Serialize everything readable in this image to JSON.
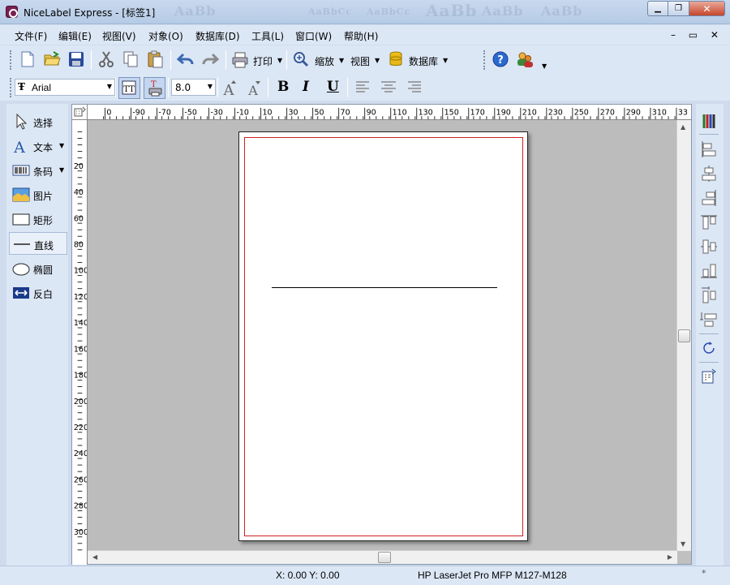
{
  "window": {
    "title": "NiceLabel Express - [标签1]",
    "ghost_text": [
      "AaBb",
      "AaBbCc",
      "AaBbCc",
      "AaBb",
      "AaBb",
      "AaBb"
    ]
  },
  "menu": {
    "items": [
      "文件(F)",
      "编辑(E)",
      "视图(V)",
      "对象(O)",
      "数据库(D)",
      "工具(L)",
      "窗口(W)",
      "帮助(H)"
    ],
    "mdi_buttons": "– ▭ ✕"
  },
  "toolbar": {
    "print_label": "打印",
    "zoom_label": "缩放",
    "view_label": "视图",
    "database_label": "数据库"
  },
  "format_bar": {
    "font_name": "Arial",
    "font_size": "8.0",
    "bold": "B",
    "italic": "I",
    "underline": "U"
  },
  "tools": [
    {
      "label": "选择",
      "icon": "cursor-icon"
    },
    {
      "label": "文本",
      "icon": "text-icon"
    },
    {
      "label": "条码",
      "icon": "barcode-icon"
    },
    {
      "label": "图片",
      "icon": "picture-icon"
    },
    {
      "label": "矩形",
      "icon": "rectangle-icon"
    },
    {
      "label": "直线",
      "icon": "line-icon",
      "selected": true
    },
    {
      "label": "椭圆",
      "icon": "ellipse-icon"
    },
    {
      "label": "反白",
      "icon": "inverse-icon"
    }
  ],
  "ruler": {
    "horizontal_labels": [
      "0",
      "-90",
      "-70",
      "-50",
      "-30",
      "-10",
      "10",
      "30",
      "50",
      "70",
      "90",
      "110",
      "130",
      "150",
      "170",
      "190",
      "210",
      "230",
      "250",
      "270",
      "290",
      "310",
      "33"
    ],
    "vertical_labels": [
      "20",
      "40",
      "60",
      "80",
      "100",
      "120",
      "140",
      "160",
      "180",
      "200",
      "220",
      "240",
      "260",
      "280",
      "300"
    ]
  },
  "status": {
    "coords": "X:  0.00 Y:  0.00",
    "printer": "HP LaserJet Pro MFP M127-M128",
    "resize_mark": "*"
  },
  "colors": {
    "margin_line": "#d02020",
    "panel": "#dce7f5",
    "canvas": "#bcbcbc"
  }
}
